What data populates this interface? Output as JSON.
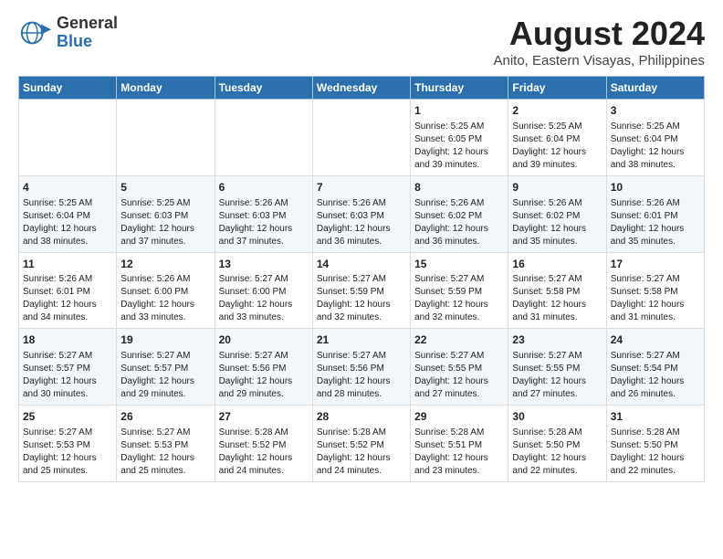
{
  "header": {
    "logo_line1": "General",
    "logo_line2": "Blue",
    "main_title": "August 2024",
    "subtitle": "Anito, Eastern Visayas, Philippines"
  },
  "days_of_week": [
    "Sunday",
    "Monday",
    "Tuesday",
    "Wednesday",
    "Thursday",
    "Friday",
    "Saturday"
  ],
  "weeks": [
    [
      {
        "day": "",
        "content": ""
      },
      {
        "day": "",
        "content": ""
      },
      {
        "day": "",
        "content": ""
      },
      {
        "day": "",
        "content": ""
      },
      {
        "day": "1",
        "content": "Sunrise: 5:25 AM\nSunset: 6:05 PM\nDaylight: 12 hours\nand 39 minutes."
      },
      {
        "day": "2",
        "content": "Sunrise: 5:25 AM\nSunset: 6:04 PM\nDaylight: 12 hours\nand 39 minutes."
      },
      {
        "day": "3",
        "content": "Sunrise: 5:25 AM\nSunset: 6:04 PM\nDaylight: 12 hours\nand 38 minutes."
      }
    ],
    [
      {
        "day": "4",
        "content": "Sunrise: 5:25 AM\nSunset: 6:04 PM\nDaylight: 12 hours\nand 38 minutes."
      },
      {
        "day": "5",
        "content": "Sunrise: 5:25 AM\nSunset: 6:03 PM\nDaylight: 12 hours\nand 37 minutes."
      },
      {
        "day": "6",
        "content": "Sunrise: 5:26 AM\nSunset: 6:03 PM\nDaylight: 12 hours\nand 37 minutes."
      },
      {
        "day": "7",
        "content": "Sunrise: 5:26 AM\nSunset: 6:03 PM\nDaylight: 12 hours\nand 36 minutes."
      },
      {
        "day": "8",
        "content": "Sunrise: 5:26 AM\nSunset: 6:02 PM\nDaylight: 12 hours\nand 36 minutes."
      },
      {
        "day": "9",
        "content": "Sunrise: 5:26 AM\nSunset: 6:02 PM\nDaylight: 12 hours\nand 35 minutes."
      },
      {
        "day": "10",
        "content": "Sunrise: 5:26 AM\nSunset: 6:01 PM\nDaylight: 12 hours\nand 35 minutes."
      }
    ],
    [
      {
        "day": "11",
        "content": "Sunrise: 5:26 AM\nSunset: 6:01 PM\nDaylight: 12 hours\nand 34 minutes."
      },
      {
        "day": "12",
        "content": "Sunrise: 5:26 AM\nSunset: 6:00 PM\nDaylight: 12 hours\nand 33 minutes."
      },
      {
        "day": "13",
        "content": "Sunrise: 5:27 AM\nSunset: 6:00 PM\nDaylight: 12 hours\nand 33 minutes."
      },
      {
        "day": "14",
        "content": "Sunrise: 5:27 AM\nSunset: 5:59 PM\nDaylight: 12 hours\nand 32 minutes."
      },
      {
        "day": "15",
        "content": "Sunrise: 5:27 AM\nSunset: 5:59 PM\nDaylight: 12 hours\nand 32 minutes."
      },
      {
        "day": "16",
        "content": "Sunrise: 5:27 AM\nSunset: 5:58 PM\nDaylight: 12 hours\nand 31 minutes."
      },
      {
        "day": "17",
        "content": "Sunrise: 5:27 AM\nSunset: 5:58 PM\nDaylight: 12 hours\nand 31 minutes."
      }
    ],
    [
      {
        "day": "18",
        "content": "Sunrise: 5:27 AM\nSunset: 5:57 PM\nDaylight: 12 hours\nand 30 minutes."
      },
      {
        "day": "19",
        "content": "Sunrise: 5:27 AM\nSunset: 5:57 PM\nDaylight: 12 hours\nand 29 minutes."
      },
      {
        "day": "20",
        "content": "Sunrise: 5:27 AM\nSunset: 5:56 PM\nDaylight: 12 hours\nand 29 minutes."
      },
      {
        "day": "21",
        "content": "Sunrise: 5:27 AM\nSunset: 5:56 PM\nDaylight: 12 hours\nand 28 minutes."
      },
      {
        "day": "22",
        "content": "Sunrise: 5:27 AM\nSunset: 5:55 PM\nDaylight: 12 hours\nand 27 minutes."
      },
      {
        "day": "23",
        "content": "Sunrise: 5:27 AM\nSunset: 5:55 PM\nDaylight: 12 hours\nand 27 minutes."
      },
      {
        "day": "24",
        "content": "Sunrise: 5:27 AM\nSunset: 5:54 PM\nDaylight: 12 hours\nand 26 minutes."
      }
    ],
    [
      {
        "day": "25",
        "content": "Sunrise: 5:27 AM\nSunset: 5:53 PM\nDaylight: 12 hours\nand 25 minutes."
      },
      {
        "day": "26",
        "content": "Sunrise: 5:27 AM\nSunset: 5:53 PM\nDaylight: 12 hours\nand 25 minutes."
      },
      {
        "day": "27",
        "content": "Sunrise: 5:28 AM\nSunset: 5:52 PM\nDaylight: 12 hours\nand 24 minutes."
      },
      {
        "day": "28",
        "content": "Sunrise: 5:28 AM\nSunset: 5:52 PM\nDaylight: 12 hours\nand 24 minutes."
      },
      {
        "day": "29",
        "content": "Sunrise: 5:28 AM\nSunset: 5:51 PM\nDaylight: 12 hours\nand 23 minutes."
      },
      {
        "day": "30",
        "content": "Sunrise: 5:28 AM\nSunset: 5:50 PM\nDaylight: 12 hours\nand 22 minutes."
      },
      {
        "day": "31",
        "content": "Sunrise: 5:28 AM\nSunset: 5:50 PM\nDaylight: 12 hours\nand 22 minutes."
      }
    ]
  ]
}
